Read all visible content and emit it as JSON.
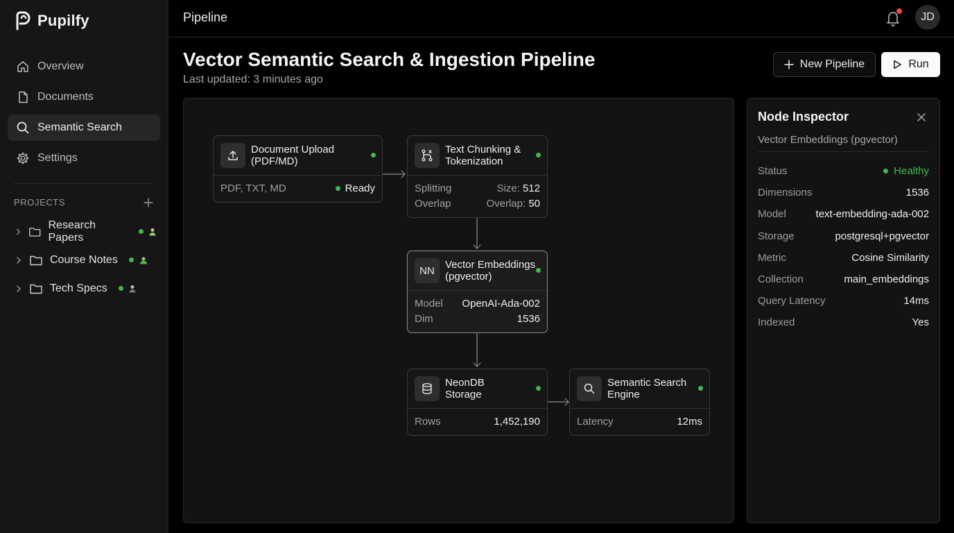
{
  "app": {
    "name": "Pupilfy"
  },
  "nav": {
    "items": [
      {
        "label": "Overview",
        "icon": "home-icon",
        "active": false
      },
      {
        "label": "Documents",
        "icon": "document-icon",
        "active": false
      },
      {
        "label": "Semantic Search",
        "icon": "search-icon",
        "active": true
      },
      {
        "label": "Settings",
        "icon": "gear-icon",
        "active": false
      }
    ]
  },
  "projects": {
    "label": "PROJECTS",
    "items": [
      {
        "name": "Research Papers"
      },
      {
        "name": "Course Notes"
      },
      {
        "name": "Tech Specs"
      }
    ]
  },
  "topbar": {
    "title": "Pipeline",
    "avatar_initials": "JD"
  },
  "header": {
    "title": "Vector Semantic Search & Ingestion Pipeline",
    "updated": "Last updated: 3 minutes ago",
    "new_label": "New Pipeline",
    "run_label": "Run"
  },
  "nodes": {
    "upload": {
      "title": "Document Upload (PDF/MD)",
      "formats": "PDF, TXT, MD",
      "status": "Ready"
    },
    "chunking": {
      "title": "Text Chunking & Tokenization",
      "row1_key": "Splitting",
      "row1_prefix": "Size: ",
      "row1_value": "512",
      "row2_key": "Overlap",
      "row2_prefix": "Overlap: ",
      "row2_value": "50"
    },
    "embeddings": {
      "icon_text": "NN",
      "title": "Vector Embeddings (pgvector)",
      "row1_key": "Model",
      "row1_value": "OpenAI-Ada-002",
      "row2_key": "Dim",
      "row2_value": "1536"
    },
    "storage": {
      "title": "NeonDB Storage",
      "row1_key": "Rows",
      "row1_value": "1,452,190"
    },
    "search": {
      "title": "Semantic Search Engine",
      "row1_key": "Latency",
      "row1_value": "12ms"
    }
  },
  "inspector": {
    "title": "Node Inspector",
    "subtitle": "Vector Embeddings (pgvector)",
    "rows": [
      {
        "key": "Status",
        "value": "Healthy"
      },
      {
        "key": "Dimensions",
        "value": "1536"
      },
      {
        "key": "Model",
        "value": "text-embedding-ada-002"
      },
      {
        "key": "Storage",
        "value": "postgresql+pgvector"
      },
      {
        "key": "Metric",
        "value": "Cosine Similarity"
      },
      {
        "key": "Collection",
        "value": "main_embeddings"
      },
      {
        "key": "Query Latency",
        "value": "14ms"
      },
      {
        "key": "Indexed",
        "value": "Yes"
      }
    ]
  },
  "colors": {
    "status_green": "#3fb950",
    "notification_red": "#f04848",
    "background": "#000000",
    "sidebar": "#161616"
  }
}
